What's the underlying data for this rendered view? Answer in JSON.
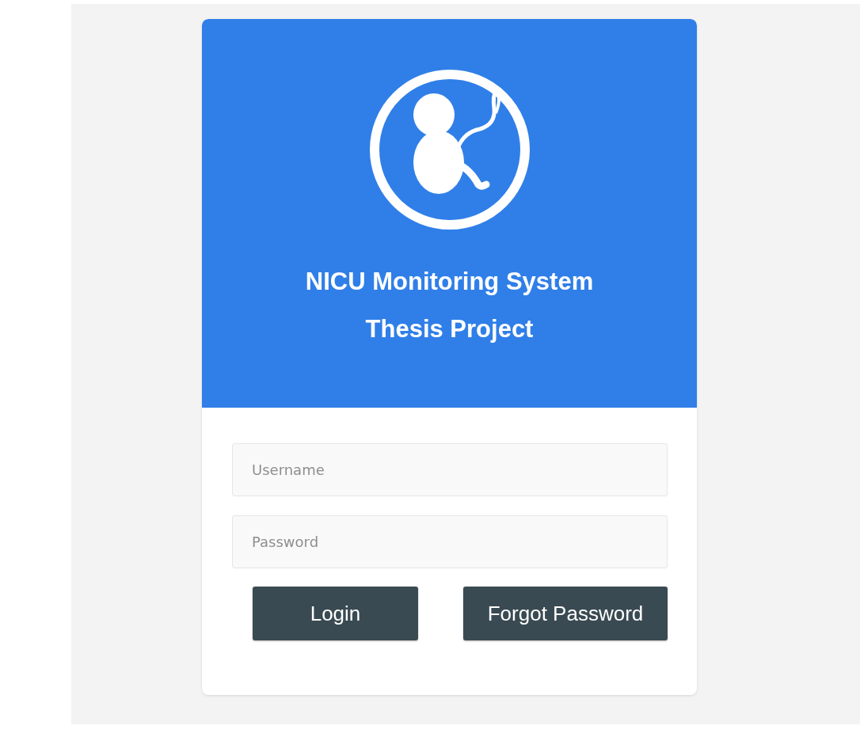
{
  "header": {
    "title_lines": [
      "NICU Monitoring System",
      "Thesis Project"
    ]
  },
  "form": {
    "fields": [
      {
        "placeholder": "Username"
      },
      {
        "placeholder": "Password"
      }
    ],
    "buttons": [
      "Login",
      "Forgot Password"
    ]
  }
}
